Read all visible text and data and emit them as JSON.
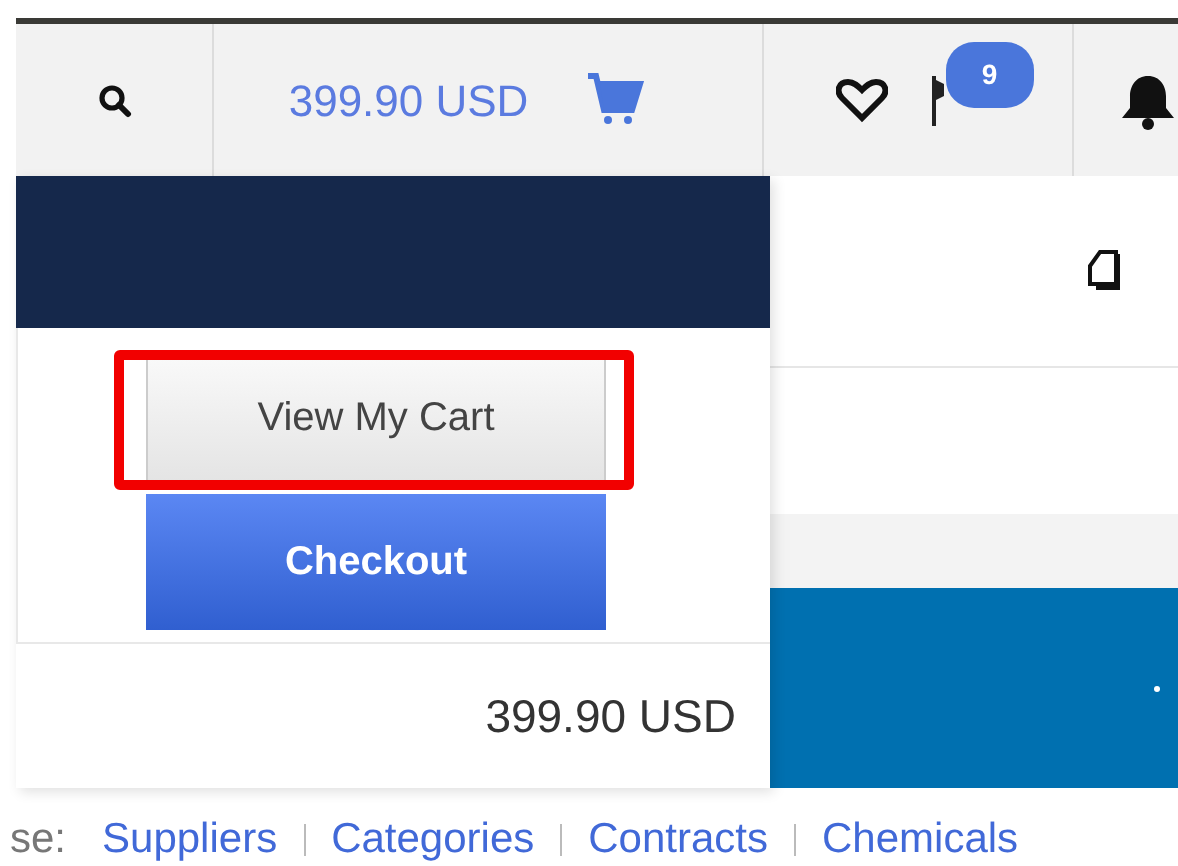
{
  "header": {
    "cart_total": "399.90 USD",
    "notifications_badge": "9"
  },
  "cart_dropdown": {
    "buttons": [
      {
        "label": "View My Cart",
        "kind": "secondary",
        "highlighted": true
      },
      {
        "label": "Checkout",
        "kind": "primary",
        "highlighted": false
      }
    ],
    "total": "399.90 USD"
  },
  "browse_links": {
    "prefix": "se:",
    "links": [
      "Suppliers",
      "Categories",
      "Contracts",
      "Chemicals"
    ]
  }
}
